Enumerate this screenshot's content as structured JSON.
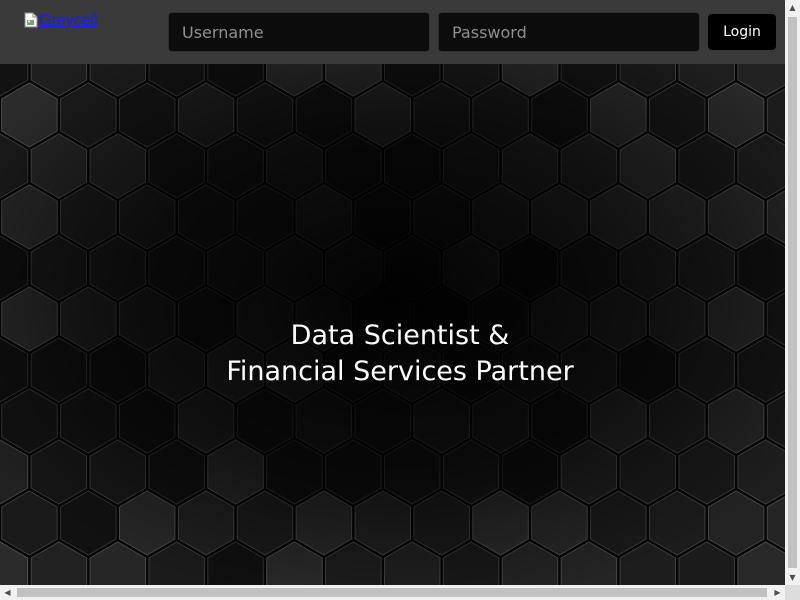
{
  "header": {
    "logo_alt": "Greycell",
    "username_placeholder": "Username",
    "password_placeholder": "Password",
    "login_label": "Login"
  },
  "hero": {
    "line1": "Data Scientist &",
    "line2": "Financial Services Partner",
    "background": "dark-hexagon-pattern"
  },
  "colors": {
    "topbar": "#3a3a3a",
    "field_bg": "#0c0c0c",
    "button_bg": "#000000",
    "text": "#ffffff",
    "link": "#1a1aff"
  },
  "icons": {
    "arrow_up": "▲",
    "arrow_down": "▼",
    "arrow_left": "◀",
    "arrow_right": "▶"
  }
}
